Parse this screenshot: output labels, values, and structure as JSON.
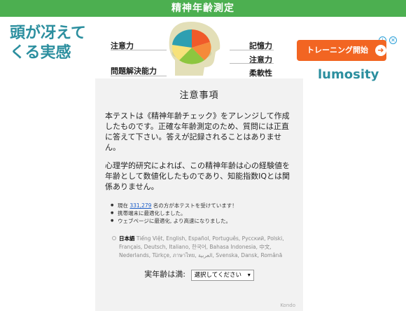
{
  "header": {
    "title": "精神年齢測定"
  },
  "ad": {
    "headline": "頭が冴えてくる実感",
    "labels_left": [
      "注意力",
      "問題解決能力"
    ],
    "labels_right": [
      "記憶力",
      "注意力",
      "柔軟性"
    ],
    "cta_label": "トレーニング開始",
    "brand": "lumosity",
    "info_icon": "info-icon",
    "close_icon": "close-icon"
  },
  "card": {
    "title": "注意事項",
    "paragraph1": "本テストは《精神年齢チェック》をアレンジして作成したものです。正確な年齢測定のため、質問には正直に答えて下さい。答えが記録されることはありません。",
    "paragraph2": "心理学的研究によれば、この精神年齢は心の経験値を年齢として数値化したものであり、知能指数IQとは関係ありません。",
    "bullets": {
      "b1_prefix": "現在",
      "b1_count": "331,279",
      "b1_suffix": "名の方が本テストを受けています！",
      "b2": "携帯端末に最適化しました。",
      "b3": "ウェブページに最適化, より高速になりました。"
    },
    "language_current": "日本語",
    "languages": "Tiếng Việt, English, Español, Português, Русский, Polski, Français, Deutsch, Italiano, 한국어, Bahasa Indonesia, 中文, Nederlands, Türkçe, ภาษาไทย, العربية, Svenska, Dansk, Română",
    "age_label": "実年齢は満:",
    "age_select": "選択してください",
    "credit": "Kondo"
  }
}
